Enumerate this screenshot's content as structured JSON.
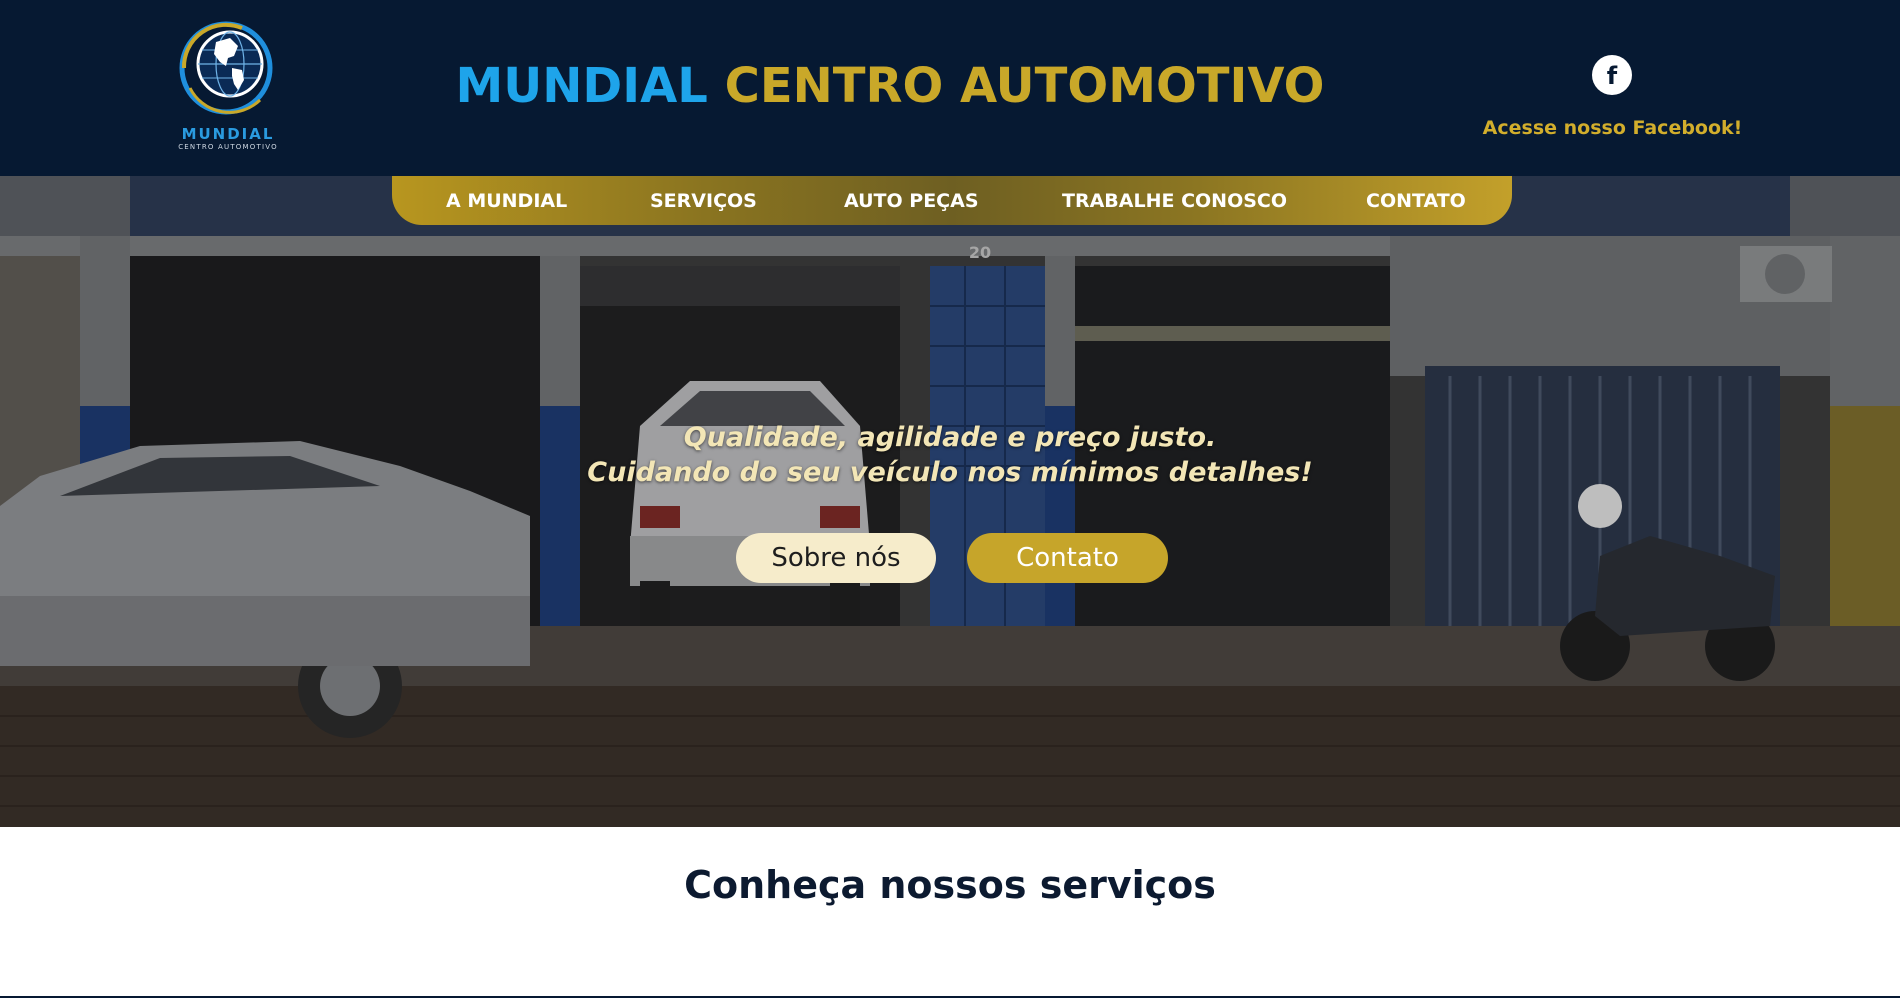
{
  "header": {
    "logo": {
      "word": "MUNDIAL",
      "sub": "CENTRO AUTOMOTIVO"
    },
    "title_part1": "MUNDIAL",
    "title_part2": "CENTRO AUTOMOTIVO",
    "facebook_icon": "facebook-icon",
    "facebook_glyph": "f",
    "facebook_text": "Acesse nosso Facebook!"
  },
  "nav": {
    "items": [
      {
        "label": "A MUNDIAL"
      },
      {
        "label": "SERVIÇOS"
      },
      {
        "label": "AUTO PEÇAS"
      },
      {
        "label": "TRABALHE CONOSCO"
      },
      {
        "label": "CONTATO"
      }
    ]
  },
  "hero": {
    "tagline_line1": "Qualidade, agilidade e preço justo.",
    "tagline_line2": "Cuidando do seu veículo nos mínimos detalhes!",
    "button_about": "Sobre nós",
    "button_contact": "Contato",
    "building_number": "20"
  },
  "services": {
    "title": "Conheça nossos serviços"
  },
  "colors": {
    "header_bg": "#061932",
    "title_blue": "#1ea4ea",
    "gold": "#c9a829",
    "cream": "#f6eccb"
  }
}
